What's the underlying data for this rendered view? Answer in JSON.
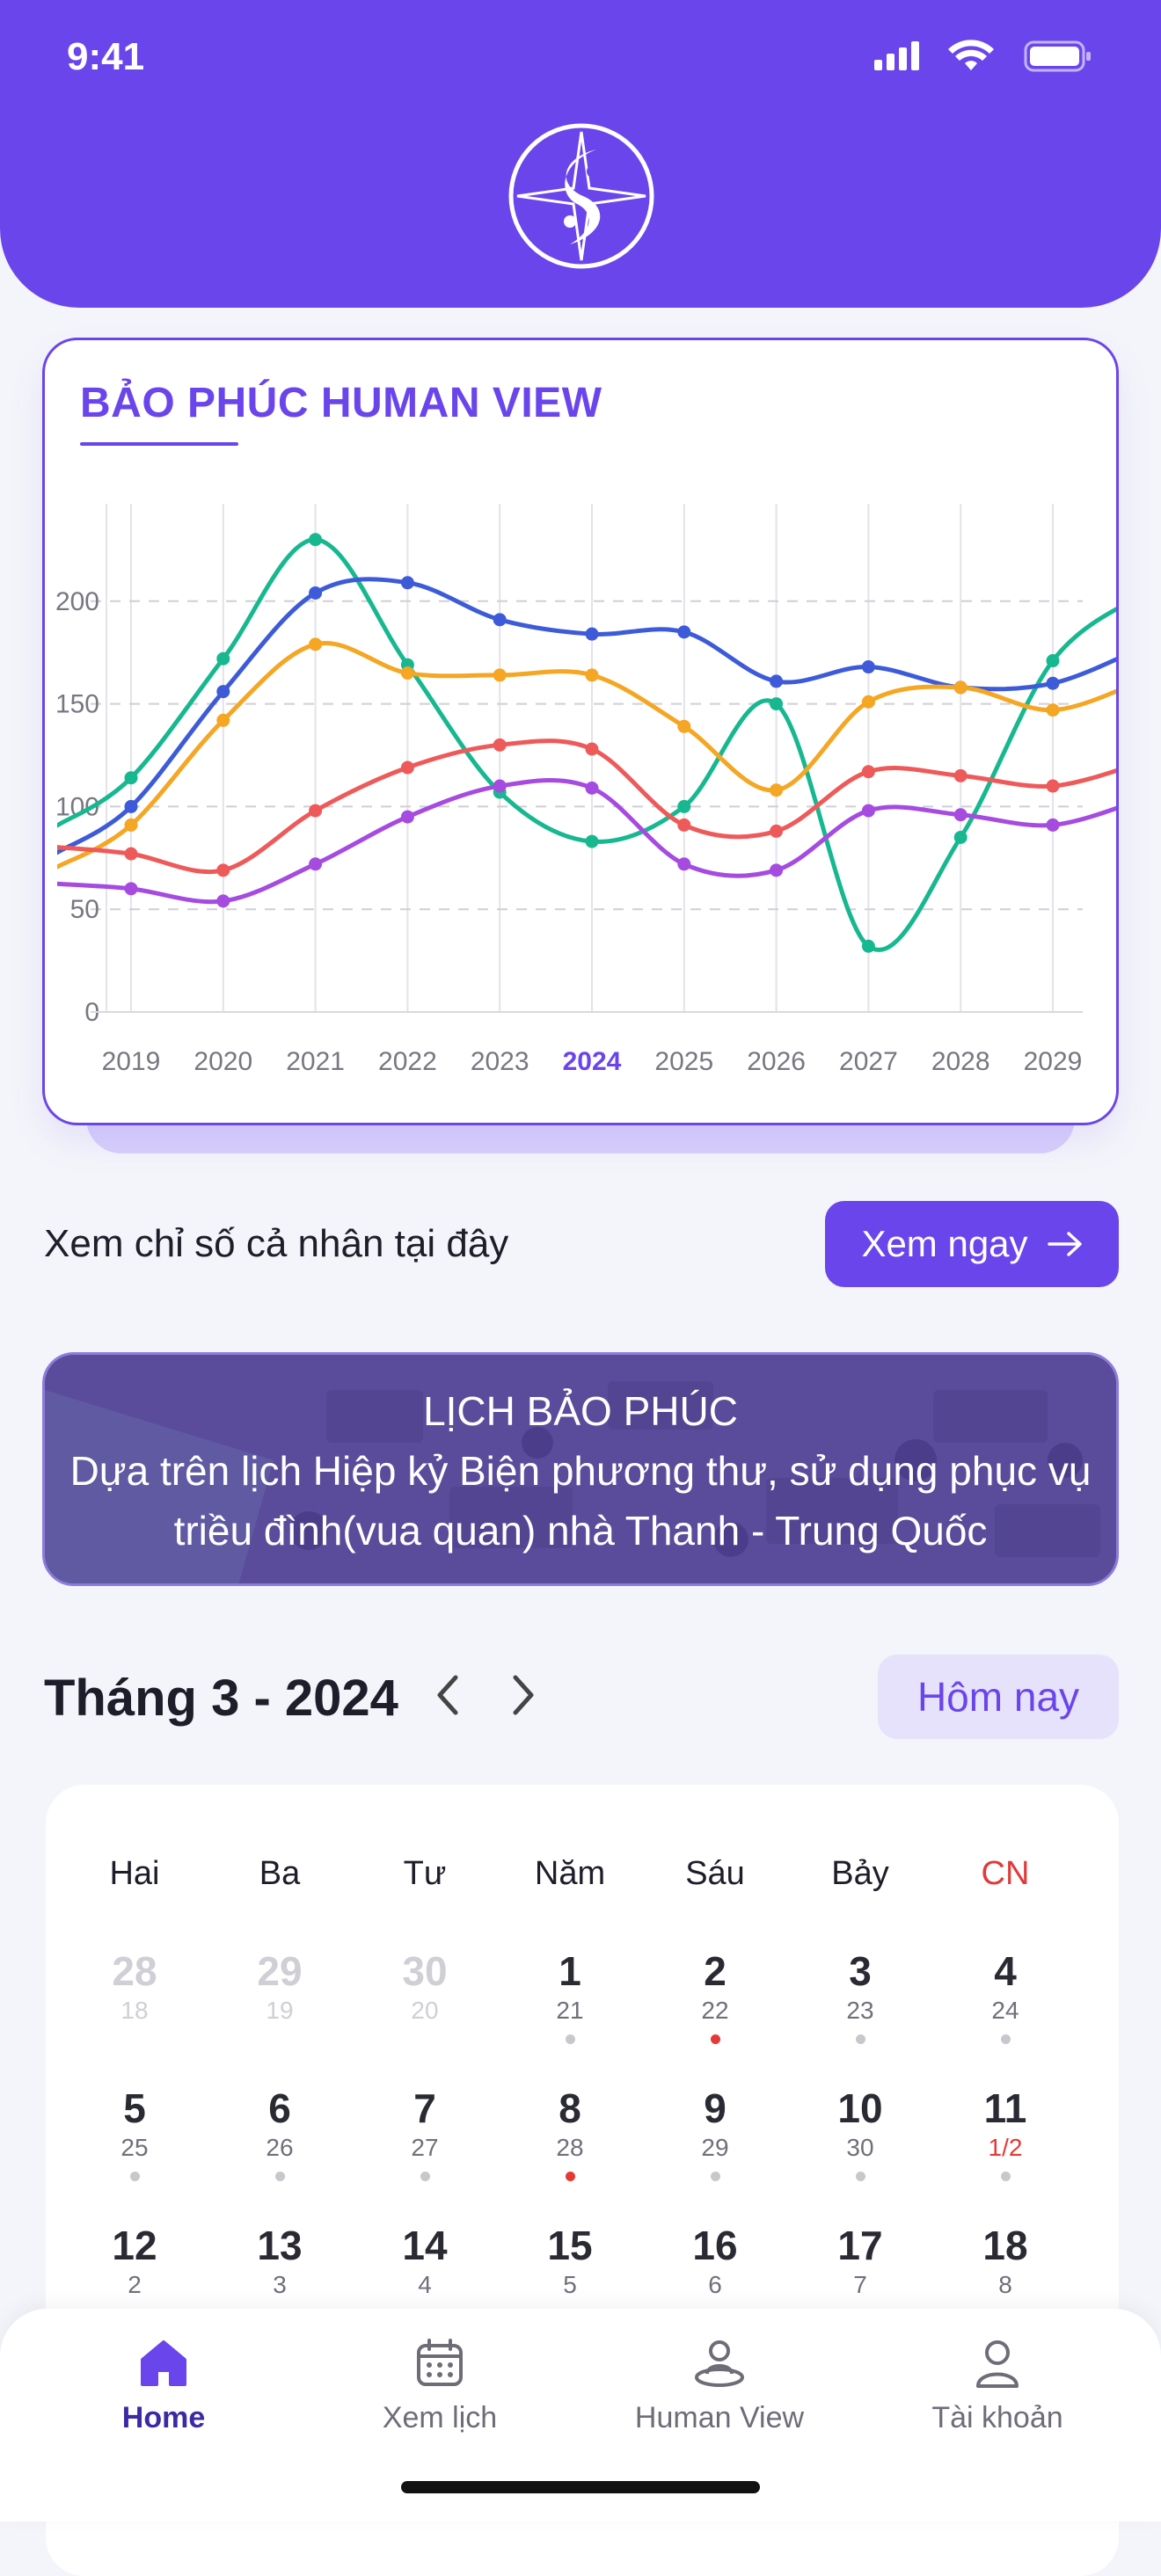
{
  "status_bar": {
    "time": "9:41"
  },
  "header": {
    "logo_icon": "compass-yin-yang-logo"
  },
  "chart_card": {
    "title": "BẢO PHÚC HUMAN VIEW",
    "highlight_year": "2024"
  },
  "chart_data": {
    "type": "line",
    "x": [
      "2019",
      "2020",
      "2021",
      "2022",
      "2023",
      "2024",
      "2025",
      "2026",
      "2027",
      "2028",
      "2029"
    ],
    "ylim": [
      0,
      250
    ],
    "yticks": [
      0,
      50,
      100,
      150,
      200
    ],
    "grid": true,
    "series": [
      {
        "color": "#17B890",
        "values": [
          114,
          172,
          230,
          169,
          107,
          83,
          100,
          150,
          32,
          85,
          171,
          204
        ]
      },
      {
        "color": "#3D5BD9",
        "values": [
          100,
          156,
          204,
          209,
          191,
          184,
          185,
          161,
          168,
          158,
          160,
          178
        ]
      },
      {
        "color": "#F5A623",
        "values": [
          91,
          142,
          179,
          165,
          164,
          164,
          139,
          108,
          151,
          158,
          147,
          162
        ]
      },
      {
        "color": "#EE5A5A",
        "values": [
          77,
          69,
          98,
          119,
          130,
          128,
          91,
          88,
          117,
          115,
          110,
          122
        ]
      },
      {
        "color": "#A64BE0",
        "values": [
          60,
          54,
          72,
          95,
          110,
          109,
          72,
          69,
          98,
          96,
          91,
          104
        ]
      }
    ]
  },
  "cta": {
    "text": "Xem chỉ số cả nhân tại đây",
    "button_label": "Xem ngay"
  },
  "banner": {
    "title": "LỊCH BẢO PHÚC",
    "line1": "Dựa trên lịch Hiệp kỷ Biện phương thư, sử dụng phục vụ",
    "line2": "triều đình(vua quan) nhà Thanh - Trung Quốc"
  },
  "calendar": {
    "month_title": "Tháng 3 - 2024",
    "today_label": "Hôm nay",
    "weekdays": [
      "Hai",
      "Ba",
      "Tư",
      "Năm",
      "Sáu",
      "Bảy",
      "CN"
    ],
    "weeks": [
      [
        {
          "d": "28",
          "l": "18",
          "muted": true,
          "dot": "none"
        },
        {
          "d": "29",
          "l": "19",
          "muted": true,
          "dot": "none"
        },
        {
          "d": "30",
          "l": "20",
          "muted": true,
          "dot": "none"
        },
        {
          "d": "1",
          "l": "21",
          "dot": "grey"
        },
        {
          "d": "2",
          "l": "22",
          "dot": "red"
        },
        {
          "d": "3",
          "l": "23",
          "dot": "grey"
        },
        {
          "d": "4",
          "l": "24",
          "dot": "grey"
        }
      ],
      [
        {
          "d": "5",
          "l": "25",
          "dot": "grey"
        },
        {
          "d": "6",
          "l": "26",
          "dot": "grey"
        },
        {
          "d": "7",
          "l": "27",
          "dot": "grey"
        },
        {
          "d": "8",
          "l": "28",
          "dot": "red"
        },
        {
          "d": "9",
          "l": "29",
          "dot": "grey"
        },
        {
          "d": "10",
          "l": "30",
          "dot": "grey"
        },
        {
          "d": "11",
          "l": "1/2",
          "dot": "grey",
          "lunar_red": true
        }
      ],
      [
        {
          "d": "12",
          "l": "2",
          "dot": "none"
        },
        {
          "d": "13",
          "l": "3",
          "dot": "none"
        },
        {
          "d": "14",
          "l": "4",
          "dot": "none"
        },
        {
          "d": "15",
          "l": "5",
          "dot": "none"
        },
        {
          "d": "16",
          "l": "6",
          "dot": "none"
        },
        {
          "d": "17",
          "l": "7",
          "dot": "none"
        },
        {
          "d": "18",
          "l": "8",
          "dot": "none"
        }
      ]
    ]
  },
  "tabs": [
    {
      "label": "Home",
      "icon": "home-icon",
      "active": true
    },
    {
      "label": "Xem lịch",
      "icon": "calendar-icon",
      "active": false
    },
    {
      "label": "Human View",
      "icon": "human-view-icon",
      "active": false
    },
    {
      "label": "Tài khoản",
      "icon": "user-icon",
      "active": false
    }
  ],
  "colors": {
    "primary": "#6A45EC",
    "accent_red": "#E53935"
  }
}
